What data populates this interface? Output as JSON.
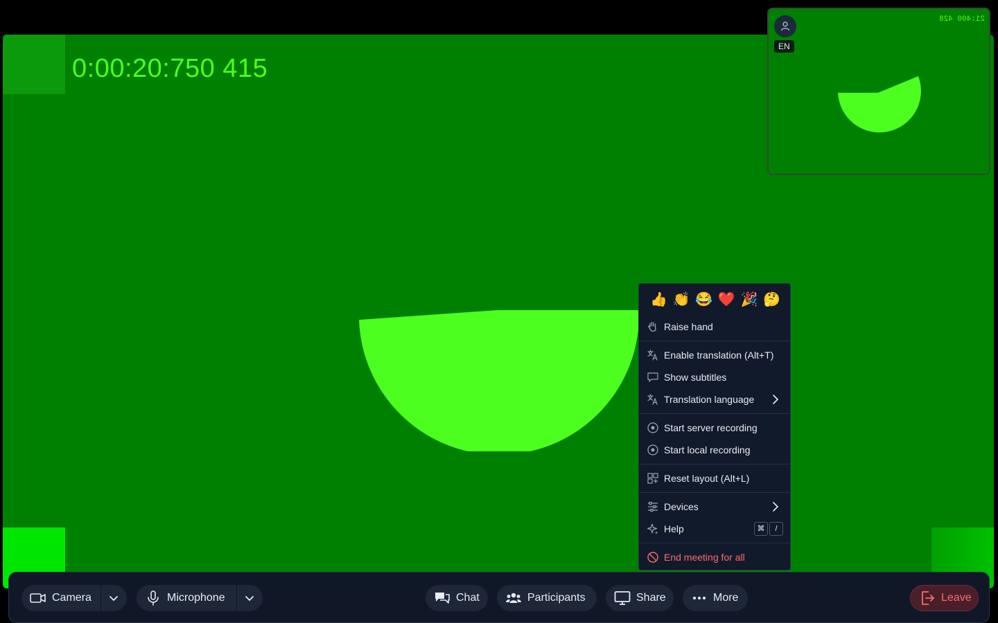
{
  "stage": {
    "timer": "0:00:20:750 415",
    "colors": {
      "background": "#008000",
      "shape": "#4cff1e"
    }
  },
  "pip": {
    "language_badge": "EN",
    "timer": "21:400 428"
  },
  "menu": {
    "reactions": [
      "👍",
      "👏",
      "😂",
      "❤️",
      "🎉",
      "🤔"
    ],
    "raise_hand": "Raise hand",
    "enable_translation": "Enable translation (Alt+T)",
    "show_subtitles": "Show subtitles",
    "translation_language": "Translation language",
    "start_server_recording": "Start server recording",
    "start_local_recording": "Start local recording",
    "reset_layout": "Reset layout (Alt+L)",
    "devices": "Devices",
    "help": "Help",
    "help_shortcut": [
      "⌘",
      "/"
    ],
    "end_meeting": "End meeting for all",
    "colors": {
      "background": "#111a2b",
      "danger": "#ff6b6b"
    }
  },
  "toolbar": {
    "camera": "Camera",
    "microphone": "Microphone",
    "chat": "Chat",
    "participants": "Participants",
    "share": "Share",
    "more": "More",
    "leave": "Leave",
    "colors": {
      "background": "#101827",
      "button": "#1d2738",
      "leave": "#ff6b6b"
    }
  }
}
